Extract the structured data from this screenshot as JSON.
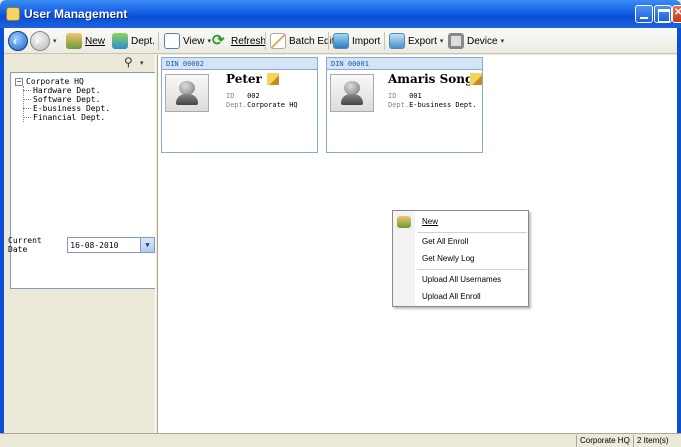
{
  "window": {
    "title": "User Management"
  },
  "toolbar": {
    "new_label": "New",
    "dept_label": "Dept.",
    "view_label": "View",
    "refresh_label": "Refresh",
    "batch_edit_label": "Batch Edit",
    "import_label": "Import",
    "export_label": "Export",
    "device_label": "Device"
  },
  "tree": {
    "root": "Corporate HQ",
    "toggle": "−",
    "children": [
      "Hardware Dept.",
      "Software Dept.",
      "E-business Dept.",
      "Financial Dept."
    ]
  },
  "current_date": {
    "label": "Current Date",
    "value": "16-08-2010"
  },
  "cards": [
    {
      "din": "DIN 00002",
      "name": "Peter",
      "id_label": "ID",
      "id": "002",
      "dept_label": "Dept.",
      "dept": "Corporate HQ"
    },
    {
      "din": "DIN 00001",
      "name": "Amaris Song",
      "id_label": "ID",
      "id": "001",
      "dept_label": "Dept.",
      "dept": "E-business Dept."
    }
  ],
  "context_menu": {
    "items": [
      "New",
      "Get All Enroll",
      "Get Newly Log",
      "Upload All Usernames",
      "Upload All Enroll"
    ]
  },
  "status": {
    "location": "Corporate HQ",
    "count": "2 Item(s)"
  },
  "icons": {
    "back": "back-arrow-icon",
    "forward": "forward-arrow-icon",
    "search": "search-icon",
    "person": "person-photo-icon",
    "edit": "edit-pencil-icon"
  }
}
